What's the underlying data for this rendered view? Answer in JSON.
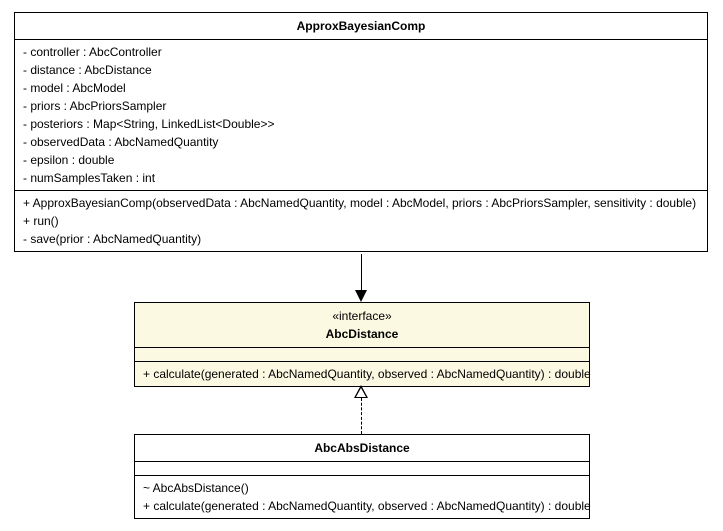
{
  "class1": {
    "name": "ApproxBayesianComp",
    "attrs": [
      "- controller : AbcController",
      "- distance : AbcDistance",
      "- model : AbcModel",
      "- priors : AbcPriorsSampler",
      "- posteriors : Map<String, LinkedList<Double>>",
      "- observedData : AbcNamedQuantity",
      "- epsilon : double",
      "- numSamplesTaken : int"
    ],
    "ops": [
      "+ ApproxBayesianComp(observedData : AbcNamedQuantity, model : AbcModel, priors : AbcPriorsSampler, sensitivity : double)",
      "+ run()",
      "- save(prior : AbcNamedQuantity)"
    ]
  },
  "class2": {
    "stereotype": "«interface»",
    "name": "AbcDistance",
    "ops": [
      "+ calculate(generated : AbcNamedQuantity, observed : AbcNamedQuantity) : double"
    ]
  },
  "class3": {
    "name": "AbcAbsDistance",
    "ops": [
      "~ AbcAbsDistance()",
      "+ calculate(generated : AbcNamedQuantity, observed : AbcNamedQuantity) : double"
    ]
  }
}
